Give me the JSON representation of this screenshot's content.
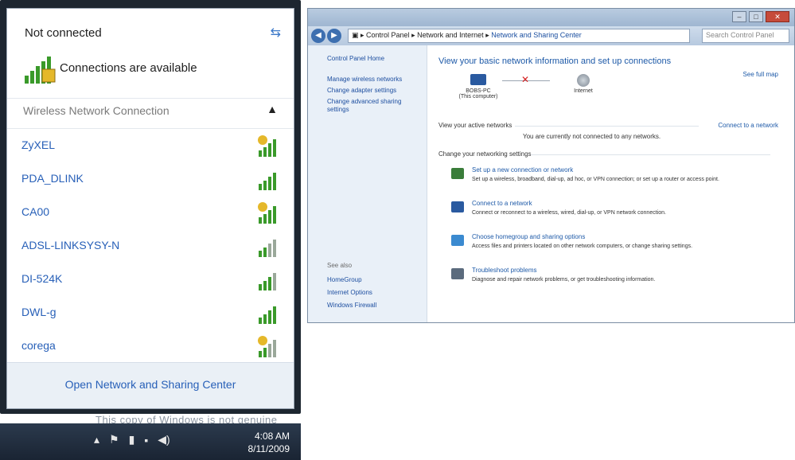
{
  "flyout": {
    "status": "Not connected",
    "available": "Connections are available",
    "section_title": "Wireless Network Connection",
    "networks": [
      {
        "name": "ZyXEL",
        "security": "open"
      },
      {
        "name": "PDA_DLINK",
        "security": "secured"
      },
      {
        "name": "CA00",
        "security": "open"
      },
      {
        "name": "ADSL-LINKSYSY-N",
        "security": "secured"
      },
      {
        "name": "DI-524K",
        "security": "secured"
      },
      {
        "name": "DWL-g",
        "security": "secured"
      },
      {
        "name": "corega",
        "security": "open"
      }
    ],
    "footer_link": "Open Network and Sharing Center"
  },
  "desktop": {
    "watermark": "This copy of Windows is not genuine"
  },
  "taskbar": {
    "time": "4:08 AM",
    "date": "8/11/2009"
  },
  "window": {
    "address": {
      "crumb1": "Control Panel",
      "crumb2": "Network and Internet",
      "crumb3": "Network and Sharing Center"
    },
    "search_placeholder": "Search Control Panel",
    "left_pane": {
      "home": "Control Panel Home",
      "links": [
        "Manage wireless networks",
        "Change adapter settings",
        "Change advanced sharing settings"
      ],
      "see_also_label": "See also",
      "see_also": [
        "HomeGroup",
        "Internet Options",
        "Windows Firewall"
      ]
    },
    "main": {
      "title": "View your basic network information and set up connections",
      "see_full_map": "See full map",
      "node_pc": "BOBS-PC",
      "node_pc_sub": "(This computer)",
      "node_internet": "Internet",
      "active_label": "View your active networks",
      "active_text": "You are currently not connected to any networks.",
      "connect_link": "Connect to a network",
      "change_label": "Change your networking settings",
      "tasks": [
        {
          "title": "Set up a new connection or network",
          "desc": "Set up a wireless, broadband, dial-up, ad hoc, or VPN connection; or set up a router or access point."
        },
        {
          "title": "Connect to a network",
          "desc": "Connect or reconnect to a wireless, wired, dial-up, or VPN network connection."
        },
        {
          "title": "Choose homegroup and sharing options",
          "desc": "Access files and printers located on other network computers, or change sharing settings."
        },
        {
          "title": "Troubleshoot problems",
          "desc": "Diagnose and repair network problems, or get troubleshooting information."
        }
      ]
    }
  },
  "colors": {
    "link_blue": "#2860b8",
    "signal_green": "#3a9a2a",
    "warning_yellow": "#e5b82a"
  }
}
